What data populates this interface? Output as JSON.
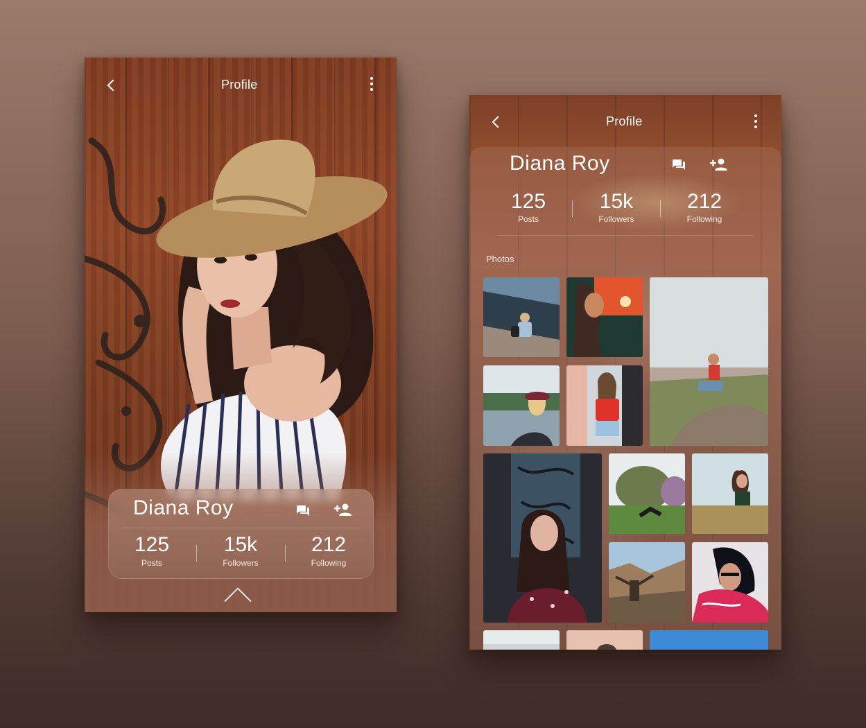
{
  "screens": [
    {
      "header": {
        "title": "Profile"
      },
      "profile": {
        "name": "Diana Roy",
        "stats": [
          {
            "value": "125",
            "label": "Posts"
          },
          {
            "value": "15k",
            "label": "Followers"
          },
          {
            "value": "212",
            "label": "Following"
          }
        ]
      },
      "icons": {
        "back": "chevron-left-icon",
        "more": "more-vert-icon",
        "chat": "chat-icon",
        "add_user": "add-user-icon",
        "expand": "chevron-up-icon"
      }
    },
    {
      "header": {
        "title": "Profile"
      },
      "profile": {
        "name": "Diana Roy",
        "stats": [
          {
            "value": "125",
            "label": "Posts"
          },
          {
            "value": "15k",
            "label": "Followers"
          },
          {
            "value": "212",
            "label": "Following"
          }
        ]
      },
      "photos_heading": "Photos",
      "icons": {
        "back": "chevron-left-icon",
        "more": "more-vert-icon",
        "chat": "chat-icon",
        "add_user": "add-user-icon"
      }
    }
  ]
}
